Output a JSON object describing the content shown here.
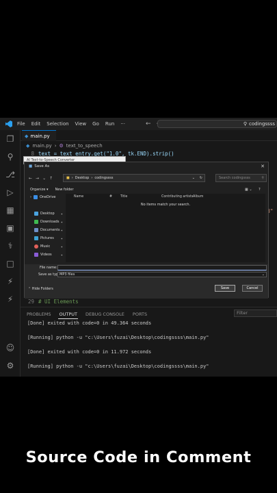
{
  "titlebar": {
    "menu": [
      "File",
      "Edit",
      "Selection",
      "View",
      "Go",
      "Run",
      "···"
    ],
    "search": "codingssss"
  },
  "editor": {
    "tab": "main.py",
    "breadcrumb_file": "main.py",
    "breadcrumb_symbol": "text_to_speech",
    "line8_num": "8",
    "line8": "text = text_entry.get(\"1.0\", tk.END).strip()",
    "peek_right": "p3\"",
    "line29_num": "29",
    "line29": "# UI Elements"
  },
  "bg_window_title": "AI Text-to-Speech Converter",
  "dialog": {
    "title": "Save As",
    "path": [
      "Desktop",
      "codingssss"
    ],
    "search_placeholder": "Search codingssss",
    "organize": "Organize ▾",
    "new_folder": "New folder",
    "nav": [
      {
        "label": "OneDrive",
        "color": "#3a8ee6"
      },
      {
        "label": "Desktop",
        "color": "#4aa3df"
      },
      {
        "label": "Downloads",
        "color": "#3fb950"
      },
      {
        "label": "Documents",
        "color": "#6e8fc7"
      },
      {
        "label": "Pictures",
        "color": "#3da2d4"
      },
      {
        "label": "Music",
        "color": "#e0605a"
      },
      {
        "label": "Videos",
        "color": "#8a5cd6"
      }
    ],
    "columns": [
      "Name",
      "#",
      "Title",
      "Contributing artists",
      "Album"
    ],
    "empty_msg": "No items match your search.",
    "file_name_label": "File name:",
    "file_name_value": "",
    "save_type_label": "Save as type:",
    "save_type_value": "MP3 files",
    "hide_folders": "Hide Folders",
    "save": "Save",
    "cancel": "Cancel"
  },
  "panel": {
    "tabs": [
      "PROBLEMS",
      "OUTPUT",
      "DEBUG CONSOLE",
      "PORTS"
    ],
    "filter_placeholder": "Filter",
    "lines": [
      "[Done] exited with code=0 in 49.364 seconds",
      "[Running] python -u \"c:\\Users\\fuzai\\Desktop\\codingssss\\main.py\"",
      "[Done] exited with code=0 in 11.972 seconds",
      "[Running] python -u \"c:\\Users\\fuzai\\Desktop\\codingssss\\main.py\""
    ]
  },
  "caption": "Source Code in Comment",
  "colors": {
    "accent": "#0078d4",
    "background": "#000000",
    "editor_bg": "#181818"
  }
}
